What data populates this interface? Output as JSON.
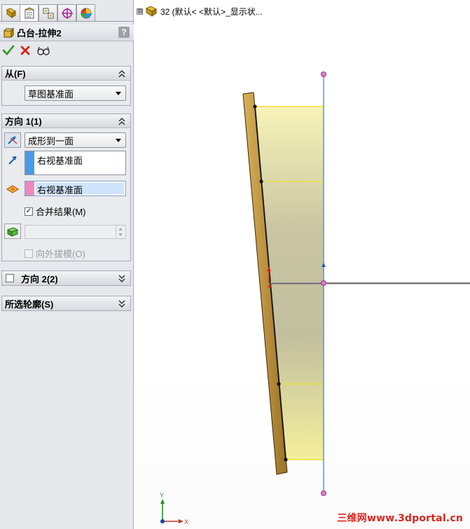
{
  "feature_tree": {
    "expander": "⊞",
    "item_label": "32  (默认< <默认>_显示状..."
  },
  "property_manager": {
    "title": "凸台-拉伸2",
    "help": "?",
    "tabs": [
      "feature-manager",
      "property-manager",
      "configuration-manager",
      "dim-xpert",
      "display-manager"
    ],
    "actions": [
      "ok",
      "cancel",
      "detailed-preview"
    ],
    "from_group": {
      "title": "从(F)",
      "start_condition": "草图基准面"
    },
    "direction1_group": {
      "title": "方向 1(1)",
      "end_condition": "成形到一面",
      "direction_list_value": "右视基准面",
      "face_plane_value": "右视基准面",
      "merge_result_label": "合并结果(M)",
      "merge_result_checked": true,
      "draft_outward_label": "向外拔模(O)",
      "draft_outward_checked": false
    },
    "direction2_group": {
      "title": "方向 2(2)",
      "checked": false
    },
    "selected_contours_group": {
      "title": "所选轮廓(S)"
    }
  },
  "triad": {
    "x_label": "X",
    "y_label": "Y"
  },
  "watermark": "三维网www.3dportal.cn",
  "colors": {
    "accent_blue": "#4a9be6",
    "plane_pink": "#ee88bb",
    "extrude_yellow": "#f5f1b0",
    "sketch_body": "#b8882e",
    "sketch_line": "#4b95e8",
    "cancel_red": "#d8231a",
    "ok_green": "#3c9a2f",
    "watermark_red": "#d9261c"
  }
}
